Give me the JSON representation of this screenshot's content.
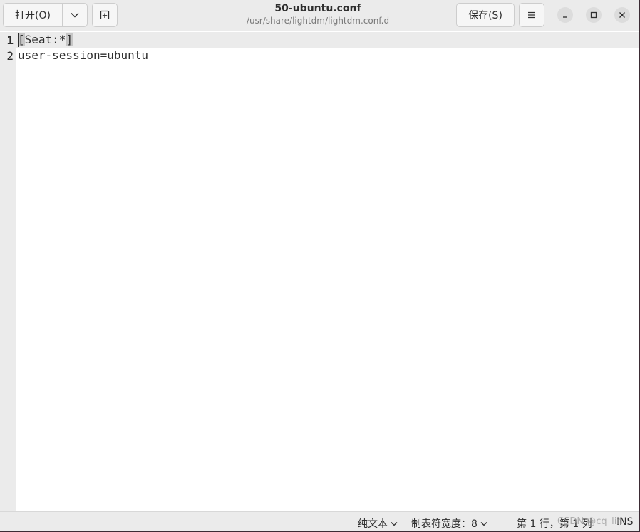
{
  "header": {
    "open_label": "打开(O)",
    "save_label": "保存(S)",
    "title": "50-ubuntu.conf",
    "subtitle": "/usr/share/lightdm/lightdm.conf.d"
  },
  "editor": {
    "lines": [
      {
        "number": "1",
        "text_open": "[",
        "text_body": "Seat:*",
        "text_close": "]"
      },
      {
        "number": "2",
        "text": "user-session=ubuntu"
      }
    ]
  },
  "status": {
    "language": "纯文本",
    "tab_width": "制表符宽度：8",
    "position": "第 1 行，第 1 列",
    "mode": "INS",
    "watermark": "CSDN @cq_lin"
  },
  "icons": {
    "dropdown": "chevron-down-icon",
    "new_tab": "new-document-icon",
    "menu": "hamburger-menu-icon",
    "minimize": "minimize-icon",
    "maximize": "maximize-icon",
    "close": "close-icon"
  }
}
